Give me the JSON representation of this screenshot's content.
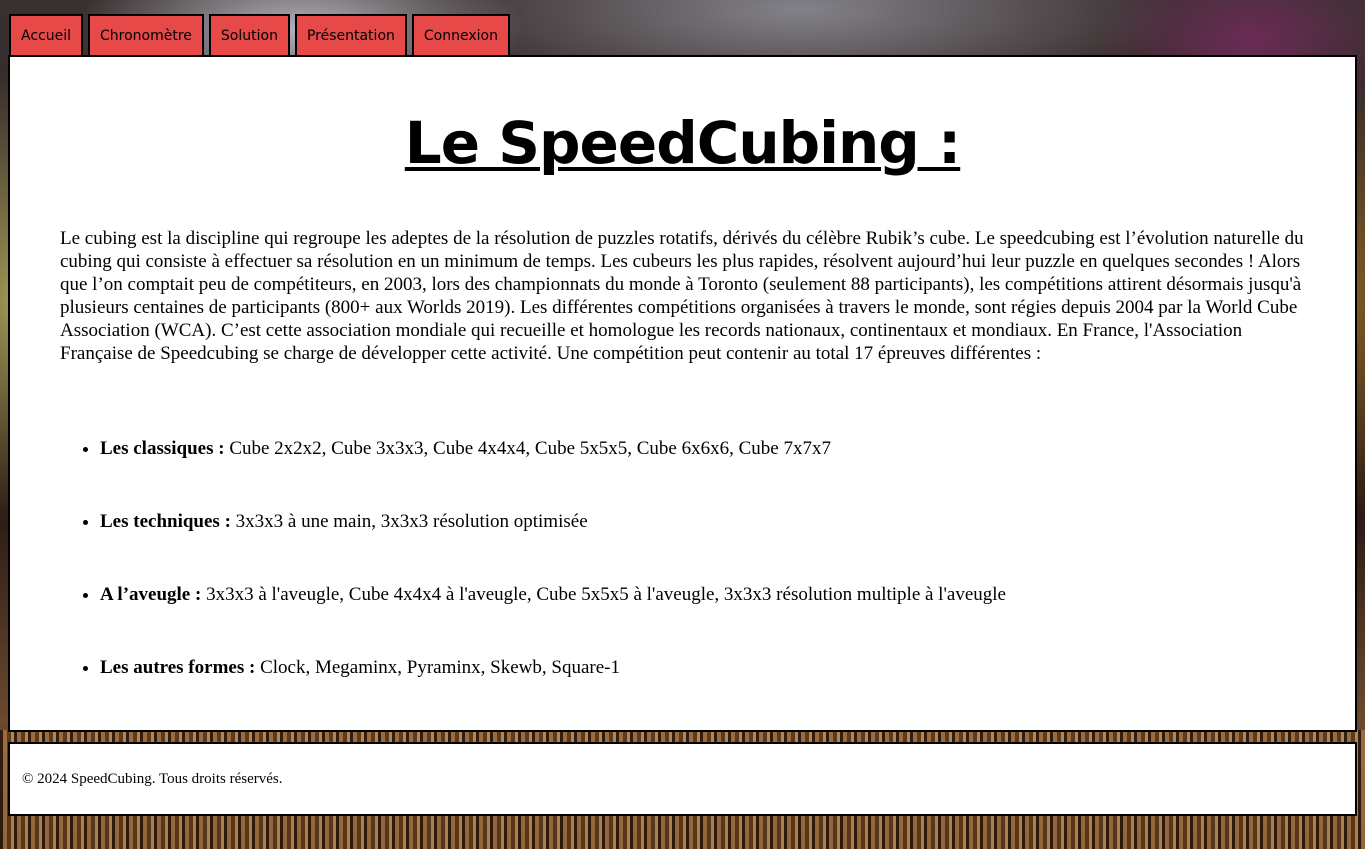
{
  "nav": {
    "items": [
      "Accueil",
      "Chronomètre",
      "Solution",
      "Présentation",
      "Connexion"
    ]
  },
  "main": {
    "title": "Le SpeedCubing :",
    "intro": "Le cubing est la discipline qui regroupe les adeptes de la résolution de puzzles rotatifs, dérivés du célèbre Rubik’s cube. Le speedcubing est l’évolution naturelle du cubing qui consiste à effectuer sa résolution en un minimum de temps. Les cubeurs les plus rapides, résolvent aujourd’hui leur puzzle en quelques secondes ! Alors que l’on comptait peu de compétiteurs, en 2003, lors des championnats du monde à Toronto (seulement 88 participants), les compétitions attirent désormais jusqu'à plusieurs centaines de participants (800+ aux Worlds 2019). Les différentes compétitions organisées à travers le monde, sont régies depuis 2004 par la World Cube Association (WCA). C’est cette association mondiale qui recueille et homologue les records nationaux, continentaux et mondiaux. En France, l'Association Française de Speedcubing se charge de développer cette activité. Une compétition peut contenir au total 17 épreuves différentes :",
    "events": [
      {
        "label": "Les classiques :",
        "text": " Cube 2x2x2, Cube 3x3x3, Cube 4x4x4, Cube 5x5x5, Cube 6x6x6, Cube 7x7x7"
      },
      {
        "label": "Les techniques :",
        "text": " 3x3x3 à une main, 3x3x3 résolution optimisée"
      },
      {
        "label": "A l’aveugle :",
        "text": " 3x3x3 à l'aveugle, Cube 4x4x4 à l'aveugle, Cube 5x5x5 à l'aveugle, 3x3x3 résolution multiple à l'aveugle"
      },
      {
        "label": "Les autres formes :",
        "text": " Clock, Megaminx, Pyraminx, Skewb, Square-1"
      }
    ]
  },
  "footer": {
    "text": "© 2024 SpeedCubing. Tous droits réservés."
  },
  "colors": {
    "nav_tab": "#e74848",
    "panel": "#ffffff",
    "border": "#000000"
  }
}
